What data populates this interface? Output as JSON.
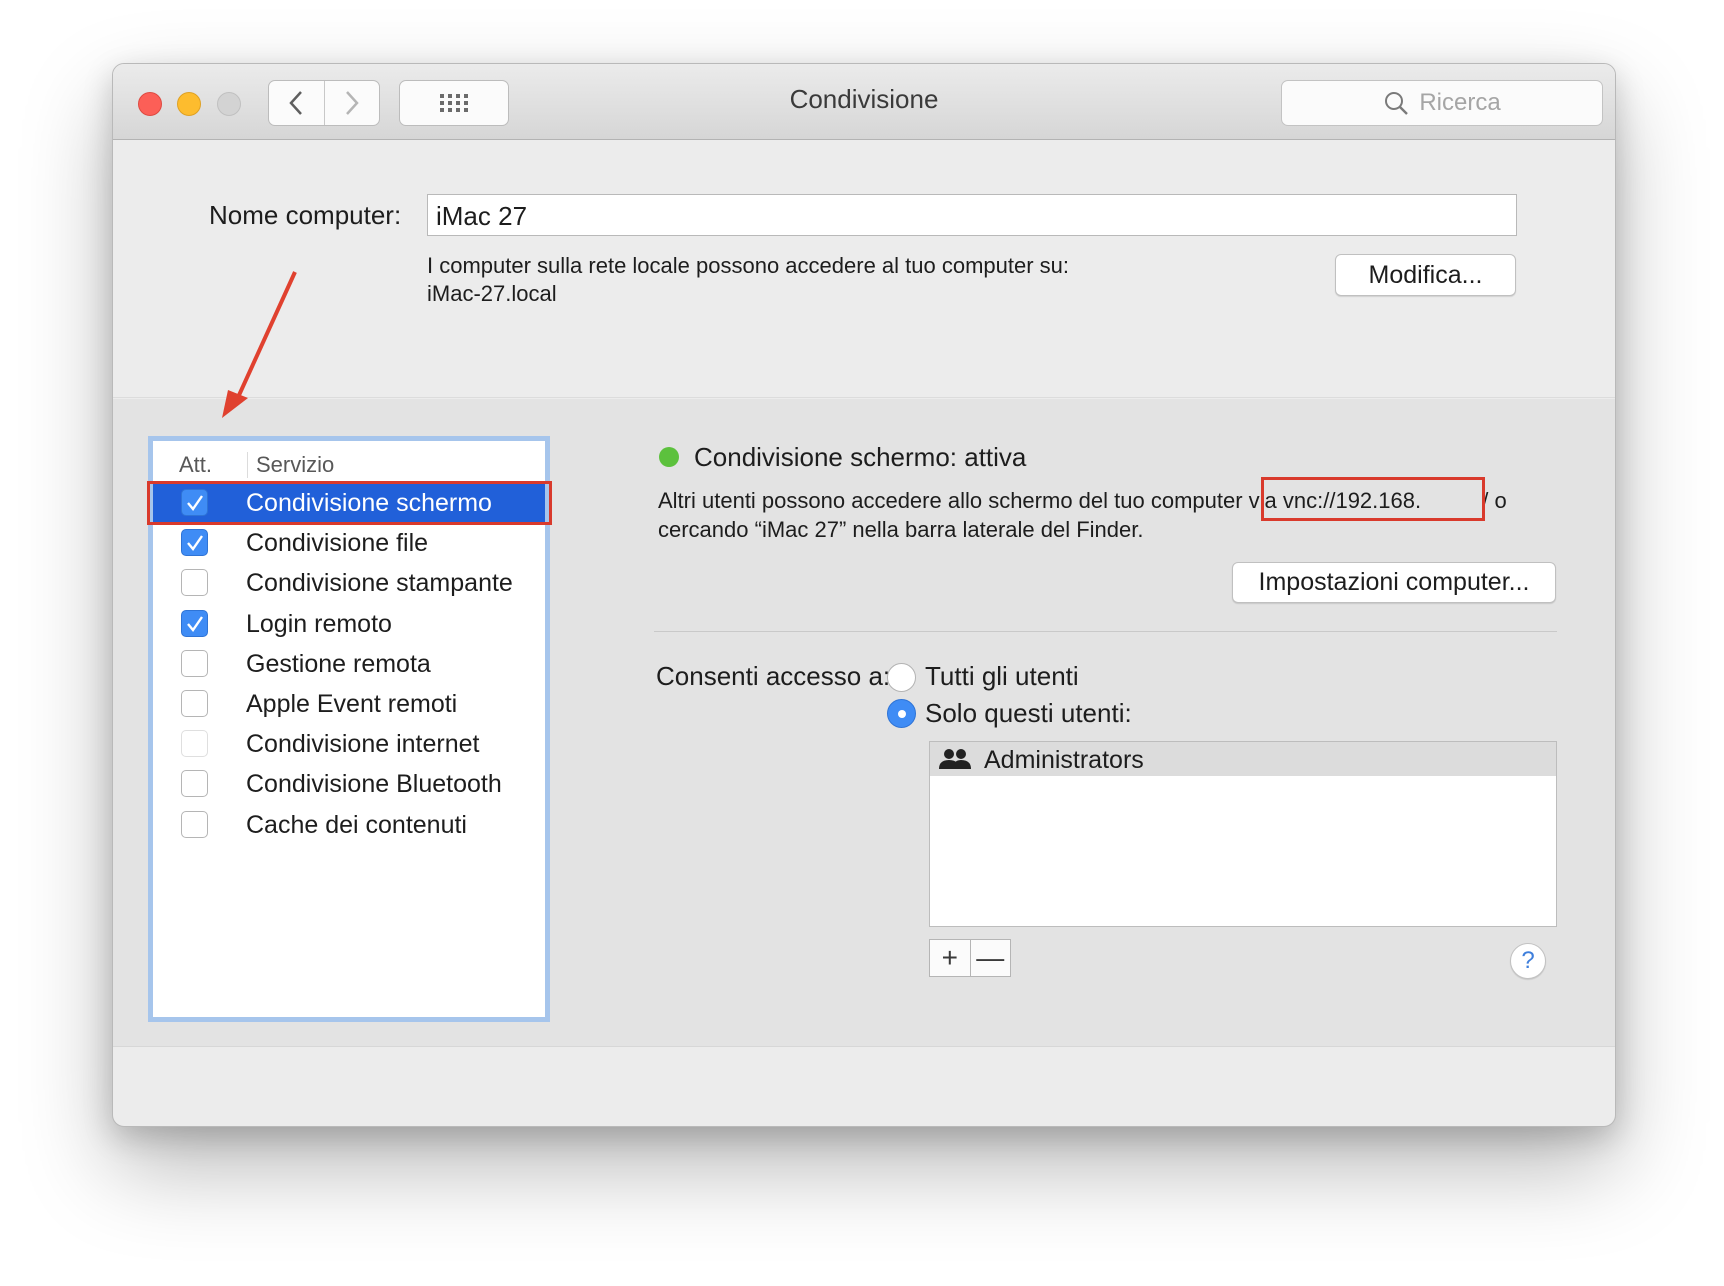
{
  "window": {
    "title": "Condivisione",
    "search_placeholder": "Ricerca"
  },
  "computer": {
    "name_label": "Nome computer:",
    "name_value": "iMac 27",
    "info_line1": "I computer sulla rete locale possono accedere al tuo computer su:",
    "info_line2": "iMac-27.local",
    "edit_button": "Modifica..."
  },
  "services": {
    "header_att": "Att.",
    "header_service": "Servizio",
    "items": [
      {
        "label": "Condivisione schermo",
        "checked": true,
        "selected": true
      },
      {
        "label": "Condivisione file",
        "checked": true
      },
      {
        "label": "Condivisione stampante",
        "checked": false
      },
      {
        "label": "Login remoto",
        "checked": true
      },
      {
        "label": "Gestione remota",
        "checked": false
      },
      {
        "label": "Apple Event remoti",
        "checked": false
      },
      {
        "label": "Condivisione internet",
        "checked": false,
        "disabled": true
      },
      {
        "label": "Condivisione Bluetooth",
        "checked": false
      },
      {
        "label": "Cache dei contenuti",
        "checked": false
      }
    ]
  },
  "detail": {
    "status_title": "Condivisione schermo: attiva",
    "status_color": "#5cc13d",
    "desc_line1": "Altri utenti possono accedere allo schermo del tuo computer via vnc://192.168.          / o",
    "desc_line2": "cercando “iMac 27” nella barra laterale del Finder.",
    "settings_button": "Impostazioni computer...",
    "access_label": "Consenti accesso a:",
    "radio_all": "Tutti gli utenti",
    "radio_only": "Solo questi utenti:",
    "users": [
      "Administrators"
    ],
    "add_symbol": "+",
    "remove_symbol": "—"
  },
  "help_symbol": "?"
}
